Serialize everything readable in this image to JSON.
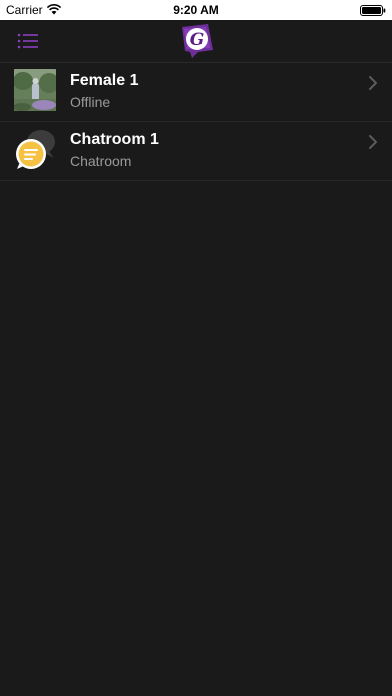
{
  "status_bar": {
    "carrier": "Carrier",
    "time": "9:20 AM"
  },
  "nav": {
    "menu_icon": "list-menu-icon",
    "logo_icon": "app-logo-icon",
    "accent_color": "#8a3fc0"
  },
  "conversations": [
    {
      "title": "Female 1",
      "subtitle": "Offline",
      "avatar": "user-photo"
    },
    {
      "title": "Chatroom 1",
      "subtitle": "Chatroom",
      "avatar": "chatroom-bubbles-icon"
    }
  ],
  "colors": {
    "background": "#1a1a1a",
    "subtitle": "#9a9a9a",
    "chatroom_badge": "#f5c243"
  }
}
